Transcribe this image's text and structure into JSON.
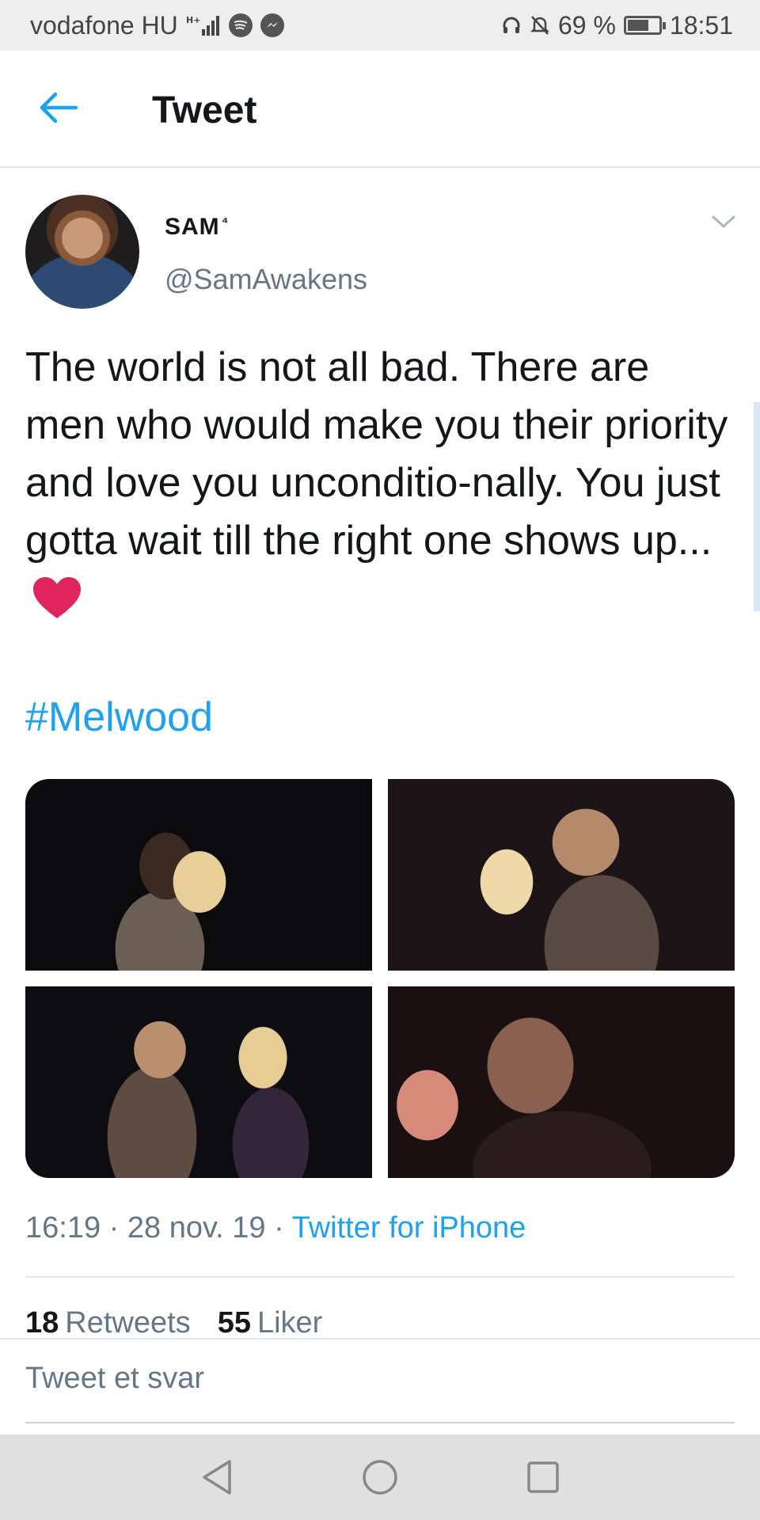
{
  "status_bar": {
    "carrier": "vodafone HU",
    "signal_label": "H+",
    "battery": "69 %",
    "battery_level": 0.69,
    "time": "18:51"
  },
  "header": {
    "title": "Tweet"
  },
  "tweet": {
    "author_name": "SAM",
    "author_mark": "⁴",
    "handle": "@SamAwakens",
    "text": "The world is not all bad. There are men who would make you their priority and love you unconditio-nally. You just gotta wait till the right one shows up...",
    "hashtag": "#Melwood",
    "time": "16:19",
    "date": "28 nov. 19",
    "source": "Twitter for iPhone",
    "separator": "·"
  },
  "stats": {
    "retweets_count": "18",
    "retweets_label": "Retweets",
    "likes_count": "55",
    "likes_label": "Liker"
  },
  "reply": {
    "placeholder": "Tweet et svar"
  },
  "colors": {
    "accent": "#1da1f2",
    "heart": "#e0245e",
    "secondary_text": "#657786"
  }
}
